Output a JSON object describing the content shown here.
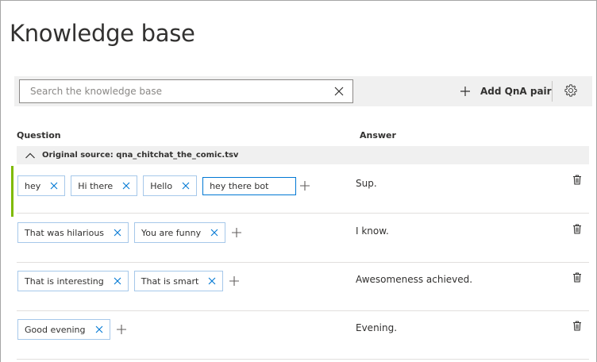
{
  "page": {
    "title": "Knowledge base"
  },
  "toolbar": {
    "search_placeholder": "Search the knowledge base",
    "add_label": "Add QnA pair"
  },
  "columns": {
    "question": "Question",
    "answer": "Answer"
  },
  "group": {
    "source_label": "Original source: qna_chitchat_the_comic.tsv"
  },
  "rows": [
    {
      "questions": [
        "hey",
        "Hi there",
        "Hello"
      ],
      "editing_value": "hey there bot",
      "answer": "Sup."
    },
    {
      "questions": [
        "That was hilarious",
        "You are funny"
      ],
      "answer": "I know."
    },
    {
      "questions": [
        "That is interesting",
        "That is smart"
      ],
      "answer": "Awesomeness achieved."
    },
    {
      "questions": [
        "Good evening"
      ],
      "answer": "Evening."
    }
  ],
  "colors": {
    "selected_accent": "#7fba00",
    "tag_border": "#a6c8ea",
    "focus_border": "#0078d4"
  },
  "icons": {
    "clear": "close-icon",
    "add": "plus-icon",
    "settings": "gear-icon",
    "collapse": "chevron-up-icon",
    "delete": "trash-icon"
  }
}
